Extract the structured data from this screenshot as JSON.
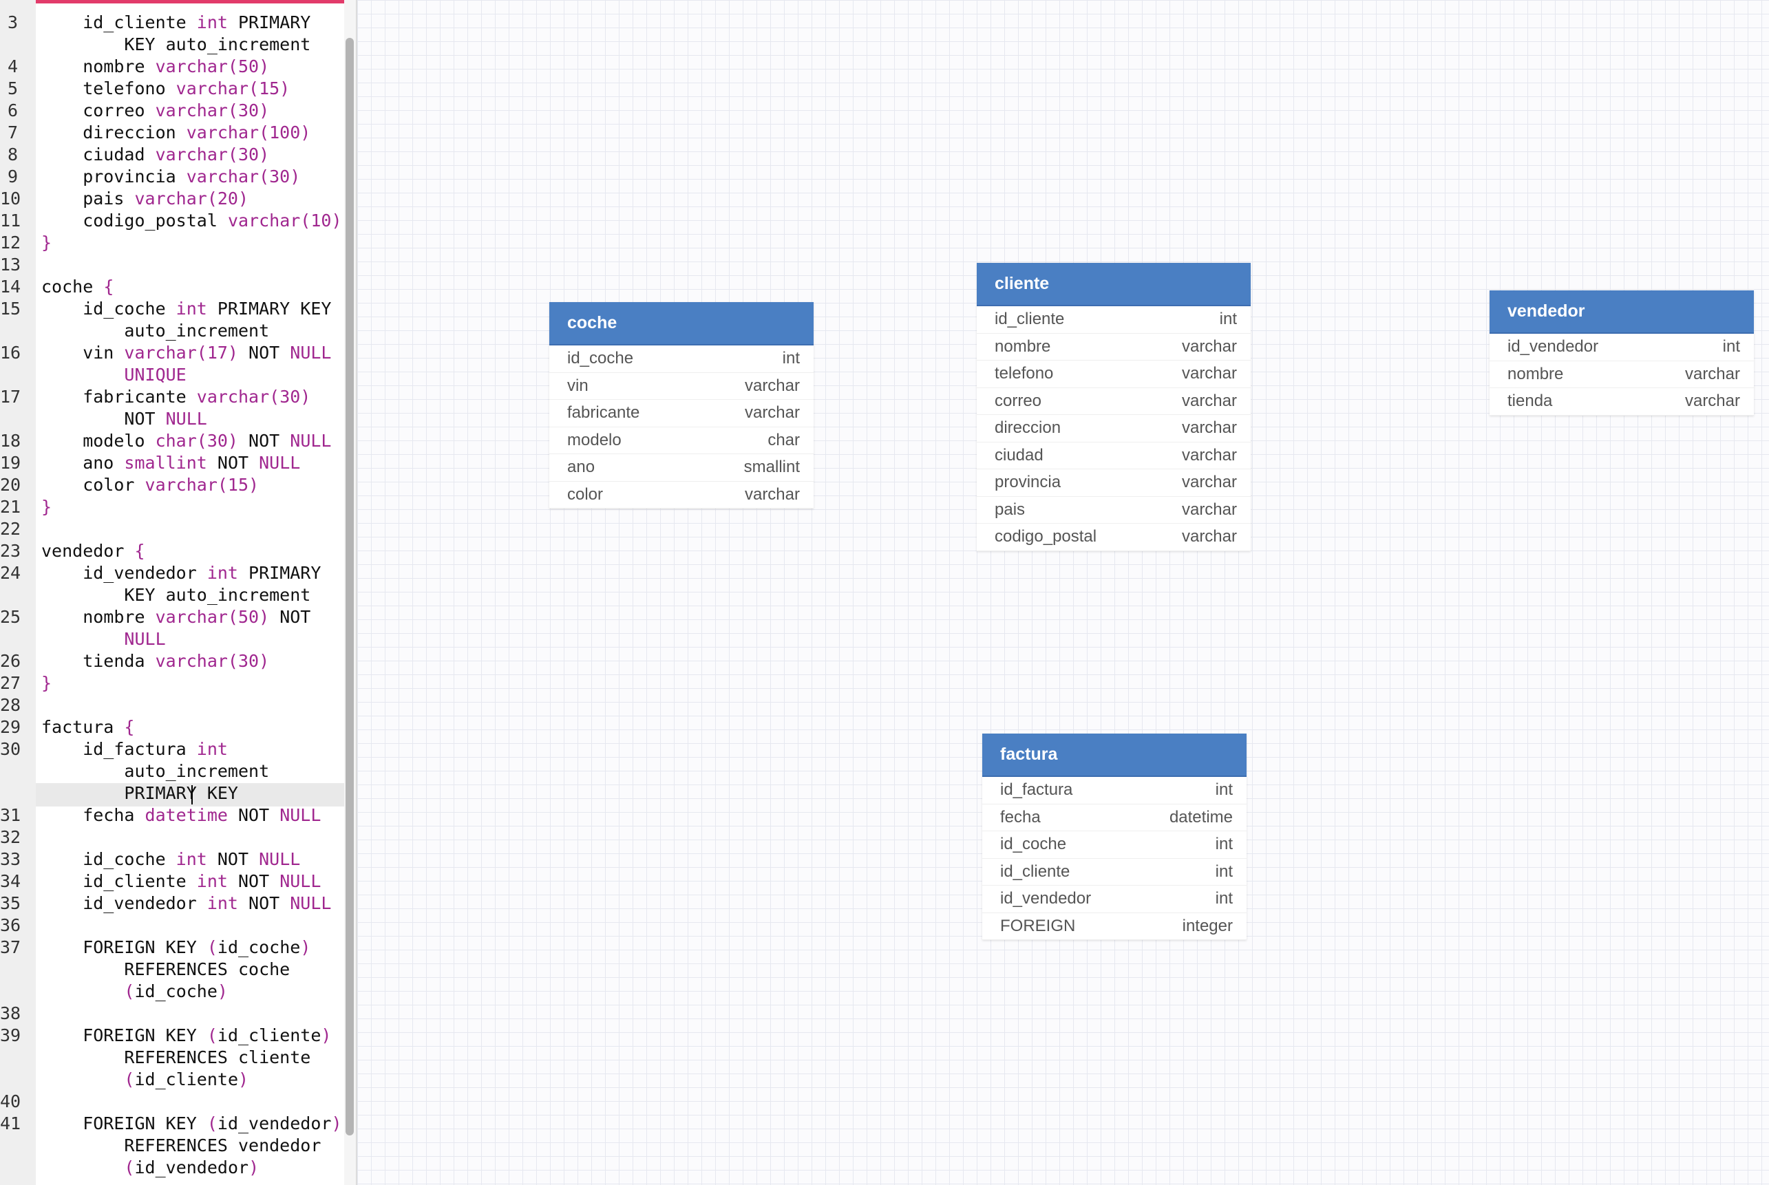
{
  "editor": {
    "lines": [
      {
        "n": "3",
        "html": "    id_cliente <span class='t'>int</span> PRIMARY"
      },
      {
        "n": "",
        "html": "        KEY auto_increment"
      },
      {
        "n": "4",
        "html": "    nombre <span class='t'>varchar(50)</span>"
      },
      {
        "n": "5",
        "html": "    telefono <span class='t'>varchar(15)</span>"
      },
      {
        "n": "6",
        "html": "    correo <span class='t'>varchar(30)</span>"
      },
      {
        "n": "7",
        "html": "    direccion <span class='t'>varchar(100)</span>"
      },
      {
        "n": "8",
        "html": "    ciudad <span class='t'>varchar(30)</span>"
      },
      {
        "n": "9",
        "html": "    provincia <span class='t'>varchar(30)</span>"
      },
      {
        "n": "10",
        "html": "    pais <span class='t'>varchar(20)</span>"
      },
      {
        "n": "11",
        "html": "    codigo_postal <span class='t'>varchar(10)</span>"
      },
      {
        "n": "12",
        "html": "<span class='p'>}</span>"
      },
      {
        "n": "13",
        "html": ""
      },
      {
        "n": "14",
        "html": "coche <span class='p'>{</span>"
      },
      {
        "n": "15",
        "html": "    id_coche <span class='t'>int</span> PRIMARY KEY"
      },
      {
        "n": "",
        "html": "        auto_increment"
      },
      {
        "n": "16",
        "html": "    vin <span class='t'>varchar(17)</span> NOT <span class='k'>NULL</span>"
      },
      {
        "n": "",
        "html": "        <span class='k'>UNIQUE</span>"
      },
      {
        "n": "17",
        "html": "    fabricante <span class='t'>varchar(30)</span>"
      },
      {
        "n": "",
        "html": "        NOT <span class='k'>NULL</span>"
      },
      {
        "n": "18",
        "html": "    modelo <span class='t'>char(30)</span> NOT <span class='k'>NULL</span>"
      },
      {
        "n": "19",
        "html": "    ano <span class='t'>smallint</span> NOT <span class='k'>NULL</span>"
      },
      {
        "n": "20",
        "html": "    color <span class='t'>varchar(15)</span>"
      },
      {
        "n": "21",
        "html": "<span class='p'>}</span>"
      },
      {
        "n": "22",
        "html": ""
      },
      {
        "n": "23",
        "html": "vendedor <span class='p'>{</span>"
      },
      {
        "n": "24",
        "html": "    id_vendedor <span class='t'>int</span> PRIMARY"
      },
      {
        "n": "",
        "html": "        KEY auto_increment"
      },
      {
        "n": "25",
        "html": "    nombre <span class='t'>varchar(50)</span> NOT"
      },
      {
        "n": "",
        "html": "        <span class='k'>NULL</span>"
      },
      {
        "n": "26",
        "html": "    tienda <span class='t'>varchar(30)</span>"
      },
      {
        "n": "27",
        "html": "<span class='p'>}</span>"
      },
      {
        "n": "28",
        "html": ""
      },
      {
        "n": "29",
        "html": "factura <span class='p'>{</span>"
      },
      {
        "n": "30",
        "html": "    id_factura <span class='t'>int</span>"
      },
      {
        "n": "",
        "html": "        auto_increment"
      },
      {
        "n": "",
        "html": "        PRIMARY KEY"
      },
      {
        "n": "31",
        "html": "    fecha <span class='t'>datetime</span> NOT <span class='k'>NULL</span>"
      },
      {
        "n": "32",
        "html": ""
      },
      {
        "n": "33",
        "html": "    id_coche <span class='t'>int</span> NOT <span class='k'>NULL</span>"
      },
      {
        "n": "34",
        "html": "    id_cliente <span class='t'>int</span> NOT <span class='k'>NULL</span>"
      },
      {
        "n": "35",
        "html": "    id_vendedor <span class='t'>int</span> NOT <span class='k'>NULL</span>"
      },
      {
        "n": "36",
        "html": ""
      },
      {
        "n": "37",
        "html": "    FOREIGN KEY <span class='p'>(</span>id_coche<span class='p'>)</span>"
      },
      {
        "n": "",
        "html": "        REFERENCES coche"
      },
      {
        "n": "",
        "html": "        <span class='p'>(</span>id_coche<span class='p'>)</span>"
      },
      {
        "n": "38",
        "html": ""
      },
      {
        "n": "39",
        "html": "    FOREIGN KEY <span class='p'>(</span>id_cliente<span class='p'>)</span>"
      },
      {
        "n": "",
        "html": "        REFERENCES cliente"
      },
      {
        "n": "",
        "html": "        <span class='p'>(</span>id_cliente<span class='p'>)</span>"
      },
      {
        "n": "40",
        "html": ""
      },
      {
        "n": "41",
        "html": "    FOREIGN KEY <span class='p'>(</span>id_vendedor<span class='p'>)</span>"
      },
      {
        "n": "",
        "html": "        REFERENCES vendedor"
      },
      {
        "n": "",
        "html": "        <span class='p'>(</span>id_vendedor<span class='p'>)</span>"
      }
    ]
  },
  "tables": {
    "coche": {
      "name": "coche",
      "columns": [
        {
          "name": "id_coche",
          "type": "int"
        },
        {
          "name": "vin",
          "type": "varchar"
        },
        {
          "name": "fabricante",
          "type": "varchar"
        },
        {
          "name": "modelo",
          "type": "char"
        },
        {
          "name": "ano",
          "type": "smallint"
        },
        {
          "name": "color",
          "type": "varchar"
        }
      ]
    },
    "cliente": {
      "name": "cliente",
      "columns": [
        {
          "name": "id_cliente",
          "type": "int"
        },
        {
          "name": "nombre",
          "type": "varchar"
        },
        {
          "name": "telefono",
          "type": "varchar"
        },
        {
          "name": "correo",
          "type": "varchar"
        },
        {
          "name": "direccion",
          "type": "varchar"
        },
        {
          "name": "ciudad",
          "type": "varchar"
        },
        {
          "name": "provincia",
          "type": "varchar"
        },
        {
          "name": "pais",
          "type": "varchar"
        },
        {
          "name": "codigo_postal",
          "type": "varchar"
        }
      ]
    },
    "vendedor": {
      "name": "vendedor",
      "columns": [
        {
          "name": "id_vendedor",
          "type": "int"
        },
        {
          "name": "nombre",
          "type": "varchar"
        },
        {
          "name": "tienda",
          "type": "varchar"
        }
      ]
    },
    "factura": {
      "name": "factura",
      "columns": [
        {
          "name": "id_factura",
          "type": "int"
        },
        {
          "name": "fecha",
          "type": "datetime"
        },
        {
          "name": "id_coche",
          "type": "int"
        },
        {
          "name": "id_cliente",
          "type": "int"
        },
        {
          "name": "id_vendedor",
          "type": "int"
        },
        {
          "name": "FOREIGN",
          "type": "integer"
        }
      ]
    }
  },
  "colors": {
    "table_header": "#4a7fc3",
    "keyword": "#a0278f",
    "editor_accent": "#e23b6a"
  }
}
